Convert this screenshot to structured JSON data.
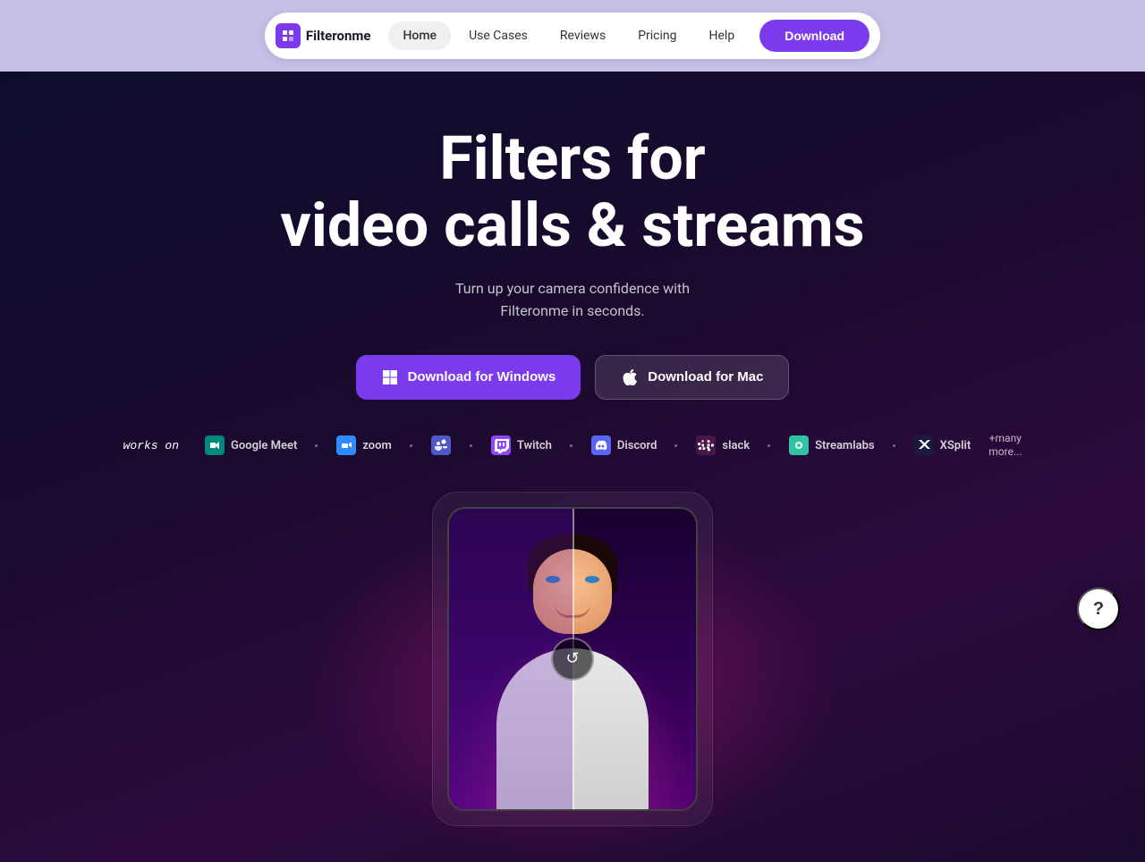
{
  "navbar": {
    "logo_text": "Filteronme",
    "links": [
      {
        "label": "Home",
        "active": true
      },
      {
        "label": "Use Cases",
        "active": false
      },
      {
        "label": "Reviews",
        "active": false
      },
      {
        "label": "Pricing",
        "active": false
      },
      {
        "label": "Help",
        "active": false
      }
    ],
    "download_label": "Download"
  },
  "hero": {
    "title_line1": "Filters for",
    "title_line2": "video calls & streams",
    "subtitle_line1": "Turn up your camera confidence with",
    "subtitle_line2": "Filteronme in seconds.",
    "btn_windows": "Download for Windows",
    "btn_mac": "Download for Mac",
    "works_on_label": "works on",
    "platforms": [
      {
        "name": "Google Meet",
        "icon": "🎥"
      },
      {
        "name": "zoom",
        "icon": "📹"
      },
      {
        "name": "Teams",
        "icon": "👥"
      },
      {
        "name": "Twitch",
        "icon": "📺"
      },
      {
        "name": "Discord",
        "icon": "🎮"
      },
      {
        "name": "Slack",
        "icon": "💬"
      },
      {
        "name": "Streamlabs",
        "icon": "🎬"
      },
      {
        "name": "XSplit",
        "icon": "🔀"
      }
    ],
    "more_label": "+many\nmore..."
  },
  "help": {
    "label": "?"
  }
}
